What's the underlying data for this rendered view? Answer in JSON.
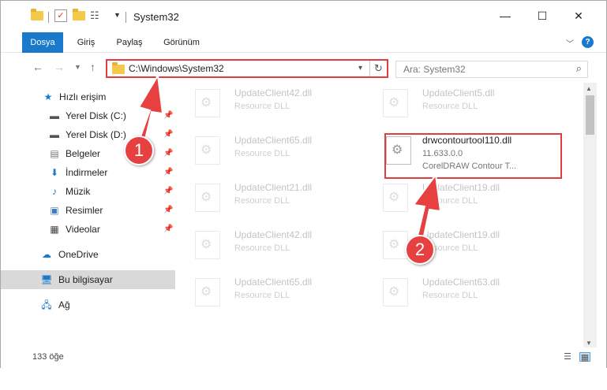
{
  "window": {
    "title": "System32",
    "controls": {
      "minimize": "—",
      "maximize": "☐",
      "close": "✕"
    }
  },
  "ribbon": {
    "tabs": [
      {
        "label": "Dosya",
        "active": true
      },
      {
        "label": "Giriş"
      },
      {
        "label": "Paylaş"
      },
      {
        "label": "Görünüm"
      }
    ],
    "help": "?"
  },
  "address": {
    "path": "C:\\Windows\\System32"
  },
  "search": {
    "placeholder": "Ara: System32"
  },
  "sidebar": {
    "quick_access": "Hızlı erişim",
    "items": [
      {
        "label": "Yerel Disk (C:)",
        "icon": "drive-icon",
        "pinned": true
      },
      {
        "label": "Yerel Disk (D:)",
        "icon": "drive-icon",
        "pinned": true
      },
      {
        "label": "Belgeler",
        "icon": "document-icon",
        "pinned": true
      },
      {
        "label": "İndirmeler",
        "icon": "download-icon",
        "pinned": true
      },
      {
        "label": "Müzik",
        "icon": "music-icon",
        "pinned": true
      },
      {
        "label": "Resimler",
        "icon": "pictures-icon",
        "pinned": true
      },
      {
        "label": "Videolar",
        "icon": "video-icon",
        "pinned": true
      }
    ],
    "onedrive": "OneDrive",
    "this_pc": "Bu bilgisayar",
    "network": "Ağ"
  },
  "files": [
    {
      "name": "UpdateClient42.dll",
      "type": "Resource DLL"
    },
    {
      "name": "UpdateClient5.dll",
      "type": "Resource DLL"
    },
    {
      "name": "UpdateClient65.dll",
      "type": "Resource DLL"
    },
    {
      "name": "drwcontourtool110.dll",
      "version": "11.633.0.0",
      "type": "CorelDRAW Contour T...",
      "highlighted": true
    },
    {
      "name": "UpdateClient21.dll",
      "type": "Resource DLL"
    },
    {
      "name": "UpdateClient19.dll",
      "type": "Resource DLL"
    },
    {
      "name": "UpdateClient42.dll",
      "type": "Resource DLL"
    },
    {
      "name": "UpdateClient19.dll",
      "type": "Resource DLL"
    },
    {
      "name": "UpdateClient65.dll",
      "type": "Resource DLL"
    },
    {
      "name": "UpdateClient63.dll",
      "type": "Resource DLL"
    }
  ],
  "status": {
    "count": "133 öğe"
  },
  "annotations": {
    "step1": "1",
    "step2": "2"
  },
  "colors": {
    "accent": "#1979ca",
    "highlight": "#e23d3d",
    "badge": "#e64040"
  }
}
